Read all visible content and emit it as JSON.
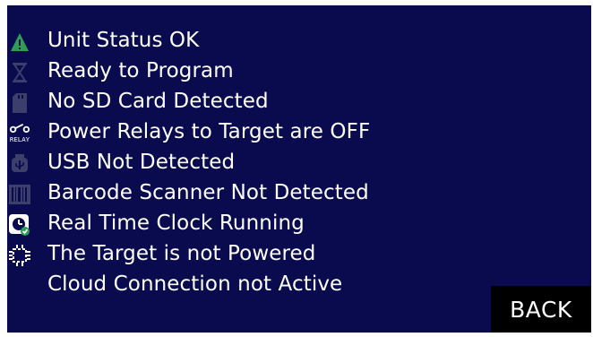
{
  "colors": {
    "background": "#0a0a4e",
    "text": "#ffffff",
    "ok_green": "#2e9e55",
    "inactive_icon": "#3b3f6a",
    "back_button_bg": "#000000"
  },
  "status_items": [
    {
      "icon": "warning-triangle-icon",
      "label": "Unit Status OK"
    },
    {
      "icon": "hourglass-icon",
      "label": "Ready to Program"
    },
    {
      "icon": "sd-card-icon",
      "label": "No SD Card Detected"
    },
    {
      "icon": "relay-icon",
      "label": "Power Relays to Target are OFF",
      "icon_text": "RELAY"
    },
    {
      "icon": "usb-icon",
      "label": "USB Not Detected"
    },
    {
      "icon": "barcode-icon",
      "label": "Barcode Scanner Not Detected"
    },
    {
      "icon": "clock-icon",
      "label": "Real Time Clock Running"
    },
    {
      "icon": "chip-icon",
      "label": "The Target is not Powered"
    },
    {
      "icon": "cloud-icon",
      "label": "Cloud Connection not Active"
    }
  ],
  "back_button": {
    "label": "BACK"
  }
}
